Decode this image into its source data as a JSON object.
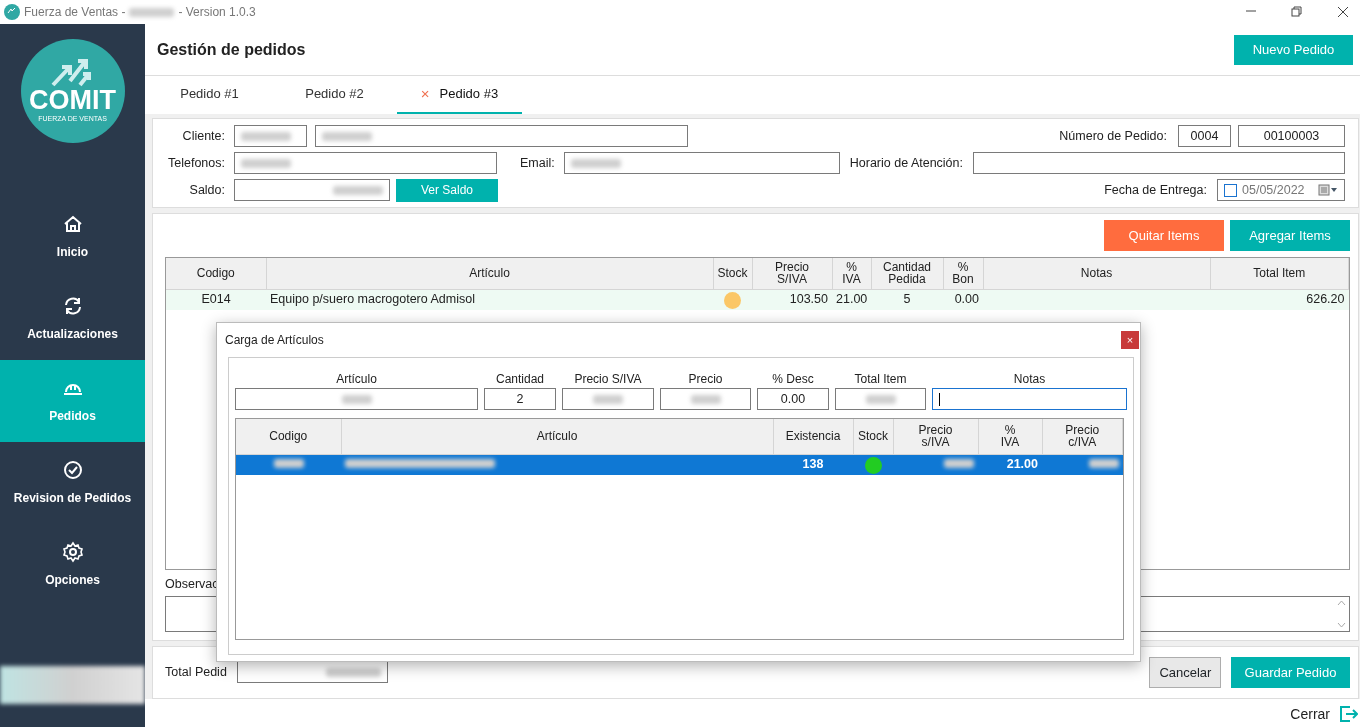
{
  "window": {
    "title_prefix": "Fuerza de Ventas -",
    "title_redacted": true,
    "title_suffix": "- Version 1.0.3"
  },
  "sidebar": {
    "logo_text": "COMIT",
    "logo_subtitle": "FUERZA DE VENTAS",
    "items": [
      {
        "label": "Inicio",
        "selected": false
      },
      {
        "label": "Actualizaciones",
        "selected": false
      },
      {
        "label": "Pedidos",
        "selected": true
      },
      {
        "label": "Revision de Pedidos",
        "selected": false
      },
      {
        "label": "Opciones",
        "selected": false
      }
    ],
    "footer_redacted": true
  },
  "header": {
    "title": "Gestión de pedidos",
    "new_button": "Nuevo Pedido"
  },
  "tabs": [
    {
      "label": "Pedido #1",
      "selected": false
    },
    {
      "label": "Pedido #2",
      "selected": false
    },
    {
      "label": "Pedido #3",
      "selected": true,
      "close": "×"
    }
  ],
  "form": {
    "cliente_label": "Cliente:",
    "cliente_code": {
      "redacted": true
    },
    "cliente_name": {
      "redacted": true
    },
    "numero_label": "Número de Pedido:",
    "numero_values": [
      "0004",
      "00100003"
    ],
    "telefonos_label": "Telefonos:",
    "telefonos": {
      "redacted": true
    },
    "email_label": "Email:",
    "email": {
      "redacted": true
    },
    "horario_label": "Horario de Atención:",
    "saldo_label": "Saldo:",
    "saldo": {
      "redacted": true
    },
    "saldo_button": "Ver Saldo",
    "fecha_label": "Fecha de Entrega:",
    "fecha": {
      "value": "05/05/2022",
      "checked": false
    }
  },
  "items": {
    "buttons": [
      {
        "label": "Quitar Items",
        "kind": "danger"
      },
      {
        "label": "Agregar Items",
        "kind": "primary"
      }
    ],
    "columns": [
      "Codigo",
      "Artículo",
      "Stock",
      "Precio\nS/IVA",
      "%\nIVA",
      "Cantidad\nPedida",
      "%\nBon",
      "Notas",
      "Total Item"
    ],
    "rows": [
      {
        "cells": [
          {
            "text": "E014"
          },
          {
            "text": "Equipo p/suero macrogotero Admisol"
          },
          {
            "kind": "stock",
            "color": "#fbc766"
          },
          {
            "text": "103.50"
          },
          {
            "text": "21.00"
          },
          {
            "text": "5"
          },
          {
            "text": "0.00"
          },
          {
            "kind": "empty"
          },
          {
            "text": "626.20"
          }
        ]
      }
    ],
    "observaciones_label": "Observac"
  },
  "footer": {
    "total_label": "Total Pedid",
    "total": {
      "redacted": true
    },
    "cancel": "Cancelar",
    "save": "Guardar Pedido"
  },
  "close_link": "Cerrar",
  "dialog": {
    "title": "Carga de Artículos",
    "close": "×",
    "fields": [
      {
        "label": "Artículo",
        "redacted": true
      },
      {
        "label": "Cantidad",
        "value": "2"
      },
      {
        "label": "Precio S/IVA",
        "redacted": true
      },
      {
        "label": "Precio",
        "redacted": true
      },
      {
        "label": "% Desc",
        "value": "0.00"
      },
      {
        "label": "Total Item",
        "redacted": true
      },
      {
        "label": "Notas",
        "focused": true
      }
    ],
    "columns": [
      "Codigo",
      "Artículo",
      "Existencia",
      "Stock",
      "Precio\ns/IVA",
      "%\nIVA",
      "Precio\nc/IVA"
    ],
    "rows": [
      {
        "selected": true,
        "cells": [
          {
            "redacted": true
          },
          {
            "redacted": true
          },
          {
            "text": "138"
          },
          {
            "kind": "stock",
            "color": "#22cc22"
          },
          {
            "redacted": true
          },
          {
            "text": "21.00"
          },
          {
            "redacted": true
          }
        ]
      }
    ]
  }
}
